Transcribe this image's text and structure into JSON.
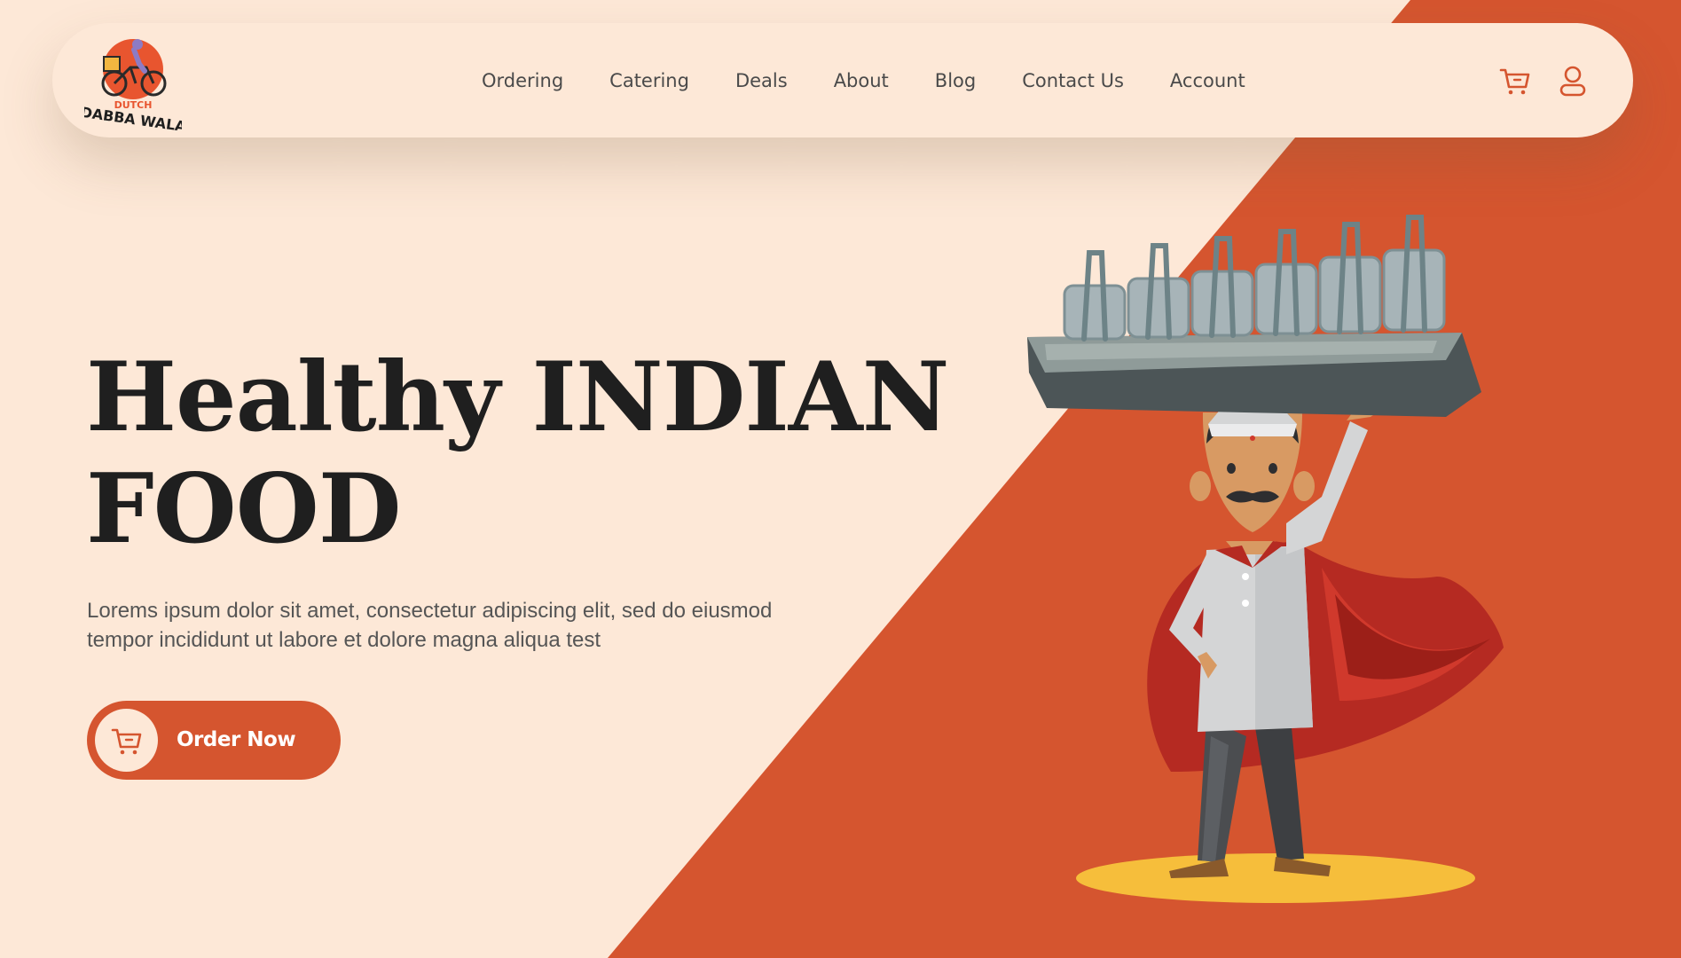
{
  "brand": {
    "logo_top": "DUTCH",
    "logo_bottom": "DABBA WALA",
    "accent_color": "#d5552f",
    "background_color": "#fde8d7",
    "text_color": "#1f1f1f"
  },
  "nav": {
    "links": [
      "Ordering",
      "Catering",
      "Deals",
      "About",
      "Blog",
      "Contact Us",
      "Account"
    ],
    "icons": [
      "cart-icon",
      "user-icon"
    ]
  },
  "hero": {
    "title_line1": "Healthy INDIAN",
    "title_line2": "FOOD",
    "description": "Lorems ipsum dolor sit amet, consectetur adipiscing elit, sed do eiusmod tempor incididunt ut labore et dolore magna aliqua test",
    "cta_label": "Order Now",
    "illustration": "dabbawala-carrying-tiffins-illustration"
  }
}
